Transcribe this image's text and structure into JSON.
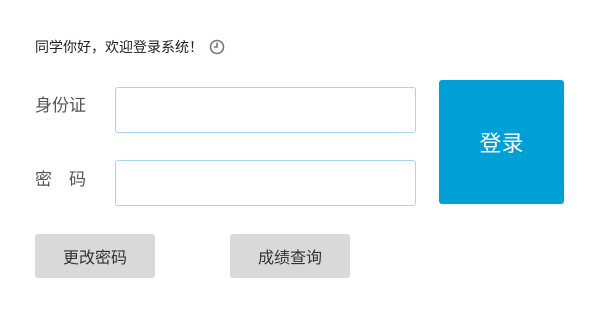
{
  "welcome": {
    "text": "同学你好，欢迎登录系统！",
    "icon": "clock-icon"
  },
  "form": {
    "username_label": "身份证",
    "password_label": "密　码",
    "username_value": "",
    "password_value": ""
  },
  "buttons": {
    "login": "登录",
    "change_password": "更改密码",
    "grade_query": "成绩查询"
  },
  "colors": {
    "accent": "#009fd6",
    "secondary_button": "#d9d9d9",
    "input_border": "#a9d4ea"
  }
}
